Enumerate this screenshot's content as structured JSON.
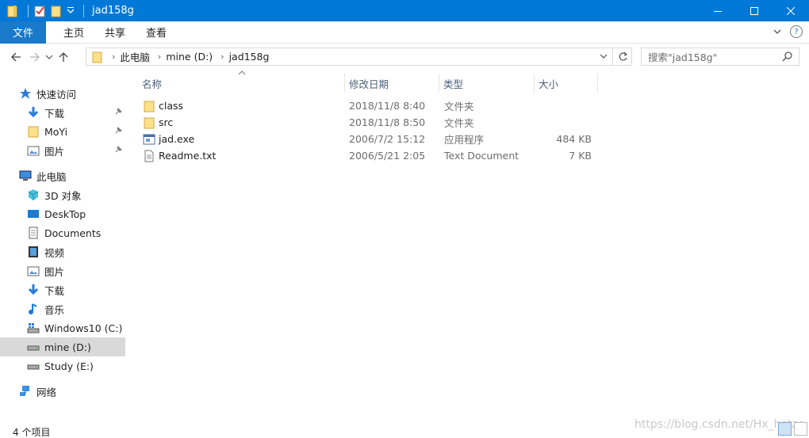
{
  "window": {
    "title": "jad158g"
  },
  "ribbon": {
    "tabs": [
      "文件",
      "主页",
      "共享",
      "查看"
    ]
  },
  "address": {
    "segments": [
      "此电脑",
      "mine (D:)",
      "jad158g"
    ]
  },
  "search": {
    "placeholder": "搜索\"jad158g\""
  },
  "nav": {
    "items": [
      {
        "label": "快速访问",
        "icon": "star-icon",
        "level": 0,
        "pinned": false
      },
      {
        "label": "下载",
        "icon": "download-icon",
        "level": 1,
        "pinned": true
      },
      {
        "label": "MoYi",
        "icon": "folder-icon",
        "level": 1,
        "pinned": true
      },
      {
        "label": "图片",
        "icon": "pictures-icon",
        "level": 1,
        "pinned": true
      },
      {
        "label": "此电脑",
        "icon": "computer-icon",
        "level": 0,
        "pinned": false
      },
      {
        "label": "3D 对象",
        "icon": "cube-icon",
        "level": 1,
        "pinned": false
      },
      {
        "label": "DeskTop",
        "icon": "desktop-icon",
        "level": 1,
        "pinned": false
      },
      {
        "label": "Documents",
        "icon": "documents-icon",
        "level": 1,
        "pinned": false
      },
      {
        "label": "视频",
        "icon": "video-icon",
        "level": 1,
        "pinned": false
      },
      {
        "label": "图片",
        "icon": "pictures-icon",
        "level": 1,
        "pinned": false
      },
      {
        "label": "下载",
        "icon": "download-icon",
        "level": 1,
        "pinned": false
      },
      {
        "label": "音乐",
        "icon": "music-icon",
        "level": 1,
        "pinned": false
      },
      {
        "label": "Windows10 (C:)",
        "icon": "drive-windows-icon",
        "level": 1,
        "pinned": false
      },
      {
        "label": "mine (D:)",
        "icon": "drive-icon",
        "level": 1,
        "pinned": false,
        "selected": true
      },
      {
        "label": "Study (E:)",
        "icon": "drive-icon",
        "level": 1,
        "pinned": false
      },
      {
        "label": "网络",
        "icon": "network-icon",
        "level": 0,
        "pinned": false
      }
    ]
  },
  "columns": {
    "name": "名称",
    "date": "修改日期",
    "type": "类型",
    "size": "大小"
  },
  "files": [
    {
      "name": "class",
      "date": "2018/11/8 8:40",
      "type": "文件夹",
      "size": "",
      "icon": "folder-icon"
    },
    {
      "name": "src",
      "date": "2018/11/8 8:50",
      "type": "文件夹",
      "size": "",
      "icon": "folder-icon"
    },
    {
      "name": "jad.exe",
      "date": "2006/7/2 15:12",
      "type": "应用程序",
      "size": "484 KB",
      "icon": "exe-icon"
    },
    {
      "name": "Readme.txt",
      "date": "2006/5/21 2:05",
      "type": "Text Document",
      "size": "7 KB",
      "icon": "text-file-icon"
    }
  ],
  "status": {
    "count": "4 个项目"
  },
  "watermark": "https://blog.csdn.net/Hx_hetze",
  "colors": {
    "titlebar": "#0078d7",
    "file_tab": "#1979ca",
    "folder": "#f7c95c"
  }
}
